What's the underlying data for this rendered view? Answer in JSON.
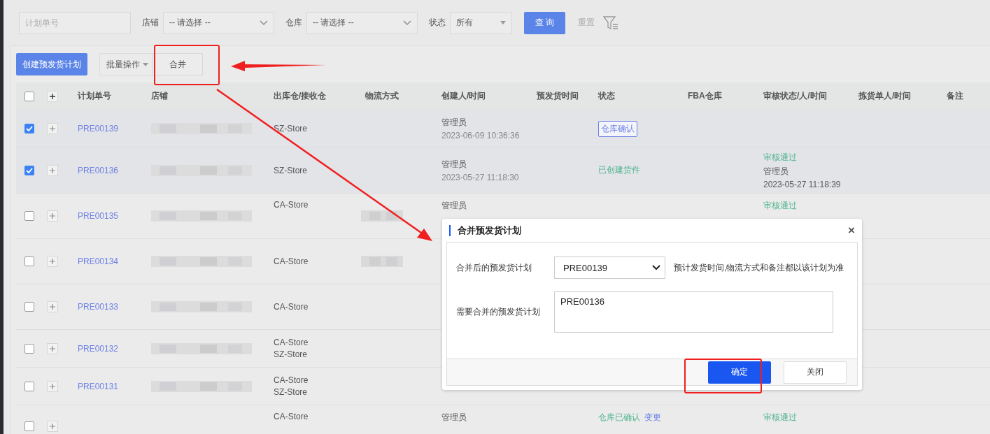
{
  "filters": {
    "plan_no": {
      "placeholder": "计划单号"
    },
    "shop": {
      "label": "店铺",
      "value": "-- 请选择 --"
    },
    "warehouse": {
      "label": "仓库",
      "value": "-- 请选择 --"
    },
    "status": {
      "label": "状态",
      "value": "所有"
    },
    "query_button": "查 询",
    "reset_button": "重置"
  },
  "toolbar": {
    "create_button": "创建预发货计划",
    "batch_button": "批量操作",
    "merge_button": "合并"
  },
  "table": {
    "all_selected": false,
    "columns": [
      "计划单号",
      "店铺",
      "出库仓/接收仓",
      "物流方式",
      "创建人/时间",
      "预发货时间",
      "状态",
      "FBA仓库",
      "审核状态/人/时间",
      "拣货单人/时间",
      "备注"
    ],
    "rows": [
      {
        "selected": true,
        "plan_no": "PRE00139",
        "shop": {
          "kind": "redacted"
        },
        "warehouses": [
          "SZ-Store"
        ],
        "creator": "管理员",
        "created": "2023-06-09 10:36:36",
        "status": [
          {
            "kind": "tag",
            "text": "仓库确认"
          }
        ]
      },
      {
        "selected": true,
        "plan_no": "PRE00136",
        "shop": {
          "kind": "redacted"
        },
        "warehouses": [
          "SZ-Store"
        ],
        "creator": "管理员",
        "created": "2023-05-27 11:18:30",
        "status": [
          {
            "kind": "text",
            "text": "已创建货件"
          }
        ],
        "review": [
          {
            "kind": "status",
            "text": "审核通过"
          },
          {
            "kind": "name",
            "text": "管理员"
          },
          {
            "kind": "time",
            "text": "2023-05-27 11:18:39"
          }
        ]
      },
      {
        "selected": false,
        "plan_no": "PRE00135",
        "shop": {
          "kind": "redacted"
        },
        "warehouses": [
          "CA-Store"
        ],
        "logistics": {
          "kind": "redacted"
        },
        "creator": "管理员",
        "review": [
          {
            "kind": "status",
            "text": "审核通过"
          }
        ]
      },
      {
        "selected": false,
        "plan_no": "PRE00134",
        "shop": {
          "kind": "redacted"
        },
        "warehouses": [
          "CA-Store"
        ],
        "logistics": {
          "kind": "redacted"
        }
      },
      {
        "selected": false,
        "plan_no": "PRE00133",
        "shop": {
          "kind": "redacted"
        },
        "warehouses": [
          "CA-Store"
        ]
      },
      {
        "selected": false,
        "plan_no": "PRE00132",
        "shop": {
          "kind": "redacted"
        },
        "warehouses": [
          "CA-Store",
          "SZ-Store"
        ]
      },
      {
        "selected": false,
        "plan_no": "PRE00131",
        "shop": {
          "kind": "redacted"
        },
        "warehouses": [
          "CA-Store",
          "SZ-Store"
        ]
      },
      {
        "selected": false,
        "warehouses": [
          "CA-Store"
        ],
        "creator": "管理员",
        "status": [
          {
            "kind": "text",
            "text": "仓库已确认"
          },
          {
            "kind": "link",
            "text": "变更"
          }
        ],
        "review": [
          {
            "kind": "status",
            "text": "审核通过"
          }
        ]
      }
    ]
  },
  "dialog": {
    "title": "合并预发货计划",
    "close": "×",
    "target_label": "合并后的预发货计划",
    "target_value": "PRE00139",
    "target_hint": "预计发货时间,物流方式和备注都以该计划为准",
    "sources_label": "需要合并的预发货计划",
    "sources_value": "PRE00136",
    "confirm_button": "确定",
    "close_button": "关闭"
  }
}
